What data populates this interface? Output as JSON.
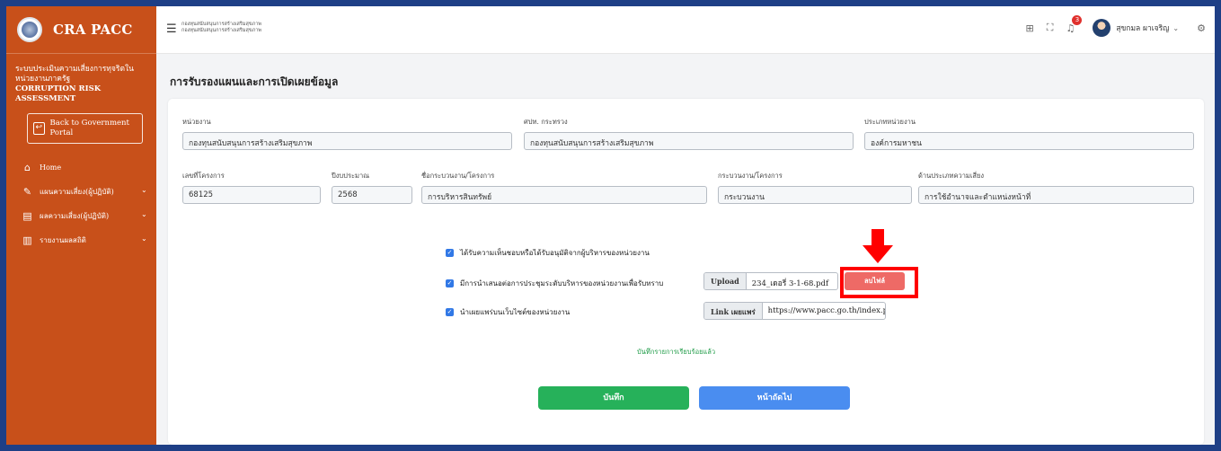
{
  "brand": {
    "name": "CRA PACC"
  },
  "sidebar": {
    "system_title_th": "ระบบประเมินความเสี่ยงการทุจริตในหน่วยงานภาครัฐ",
    "system_title_en": "CORRUPTION RISK ASSESSMENT",
    "portal_button": "Back to Government Portal",
    "items": [
      {
        "label": "Home",
        "icon": "home-icon"
      },
      {
        "label": "แผนความเสี่ยง(ผู้ปฏิบัติ)",
        "icon": "edit-icon"
      },
      {
        "label": "ผลความเสี่ยง(ผู้ปฏิบัติ)",
        "icon": "document-icon"
      },
      {
        "label": "รายงานผลสถิติ",
        "icon": "chart-icon"
      }
    ]
  },
  "topbar": {
    "breadcrumb_line1": "กองทุนสนับสนุนการสร้างเสริมสุขภาพ",
    "breadcrumb_line2": "กองทุนสนับสนุนการสร้างเสริมสุขภาพ",
    "notification_count": "3",
    "user_name": "สุขกมล ผาเจริญ"
  },
  "page": {
    "title": "การรับรองแผนและการเปิดเผยข้อมูล"
  },
  "form": {
    "row1": [
      {
        "label": "หน่วยงาน",
        "value": "กองทุนสนับสนุนการสร้างเสริมสุขภาพ"
      },
      {
        "label": "ศปท. กระทรวง",
        "value": "กองทุนสนับสนุนการสร้างเสริมสุขภาพ"
      },
      {
        "label": "ประเภทหน่วยงาน",
        "value": "องค์การมหาชน"
      }
    ],
    "row2": [
      {
        "label": "เลขที่โครงการ",
        "value": "68125"
      },
      {
        "label": "ปีงบประมาณ",
        "value": "2568"
      },
      {
        "label": "ชื่อกระบวนงาน/โครงการ",
        "value": "การบริหารสินทรัพย์"
      },
      {
        "label": "กระบวนงาน/โครงการ",
        "value": "กระบวนงาน"
      },
      {
        "label": "ด้านประเภทความเสี่ยง",
        "value": "การใช้อำนาจและตำแหน่งหน้าที่"
      }
    ]
  },
  "checks": {
    "approval": {
      "label": "ได้รับความเห็นชอบหรือได้รับอนุมัติจากผู้บริหารของหน่วยงาน",
      "checked": true
    },
    "presented": {
      "label": "มีการนำเสนอต่อการประชุมระดับบริหารของหน่วยงานเพื่อรับทราบ",
      "checked": true
    },
    "published": {
      "label": "นำเผยแพร่บนเว็บไซต์ของหน่วยงาน",
      "checked": true
    }
  },
  "upload": {
    "prefix": "Upload",
    "file_name": "234_เดอรี่ 3-1-68.pdf",
    "delete_label": "ลบไฟล์"
  },
  "publish_link": {
    "prefix": "Link เผยแพร่",
    "url": "https://www.pacc.go.th/index.php"
  },
  "status": {
    "saved_message": "บันทึกรายการเรียบร้อยแล้ว"
  },
  "buttons": {
    "save": "บันทึก",
    "next": "หน้าถัดไป"
  },
  "colors": {
    "sidebar": "#c8501a",
    "frame": "#1e3f86",
    "save": "#26b15a",
    "next": "#4a8df0",
    "delete": "#ee6a66",
    "highlight": "#ff0000"
  }
}
